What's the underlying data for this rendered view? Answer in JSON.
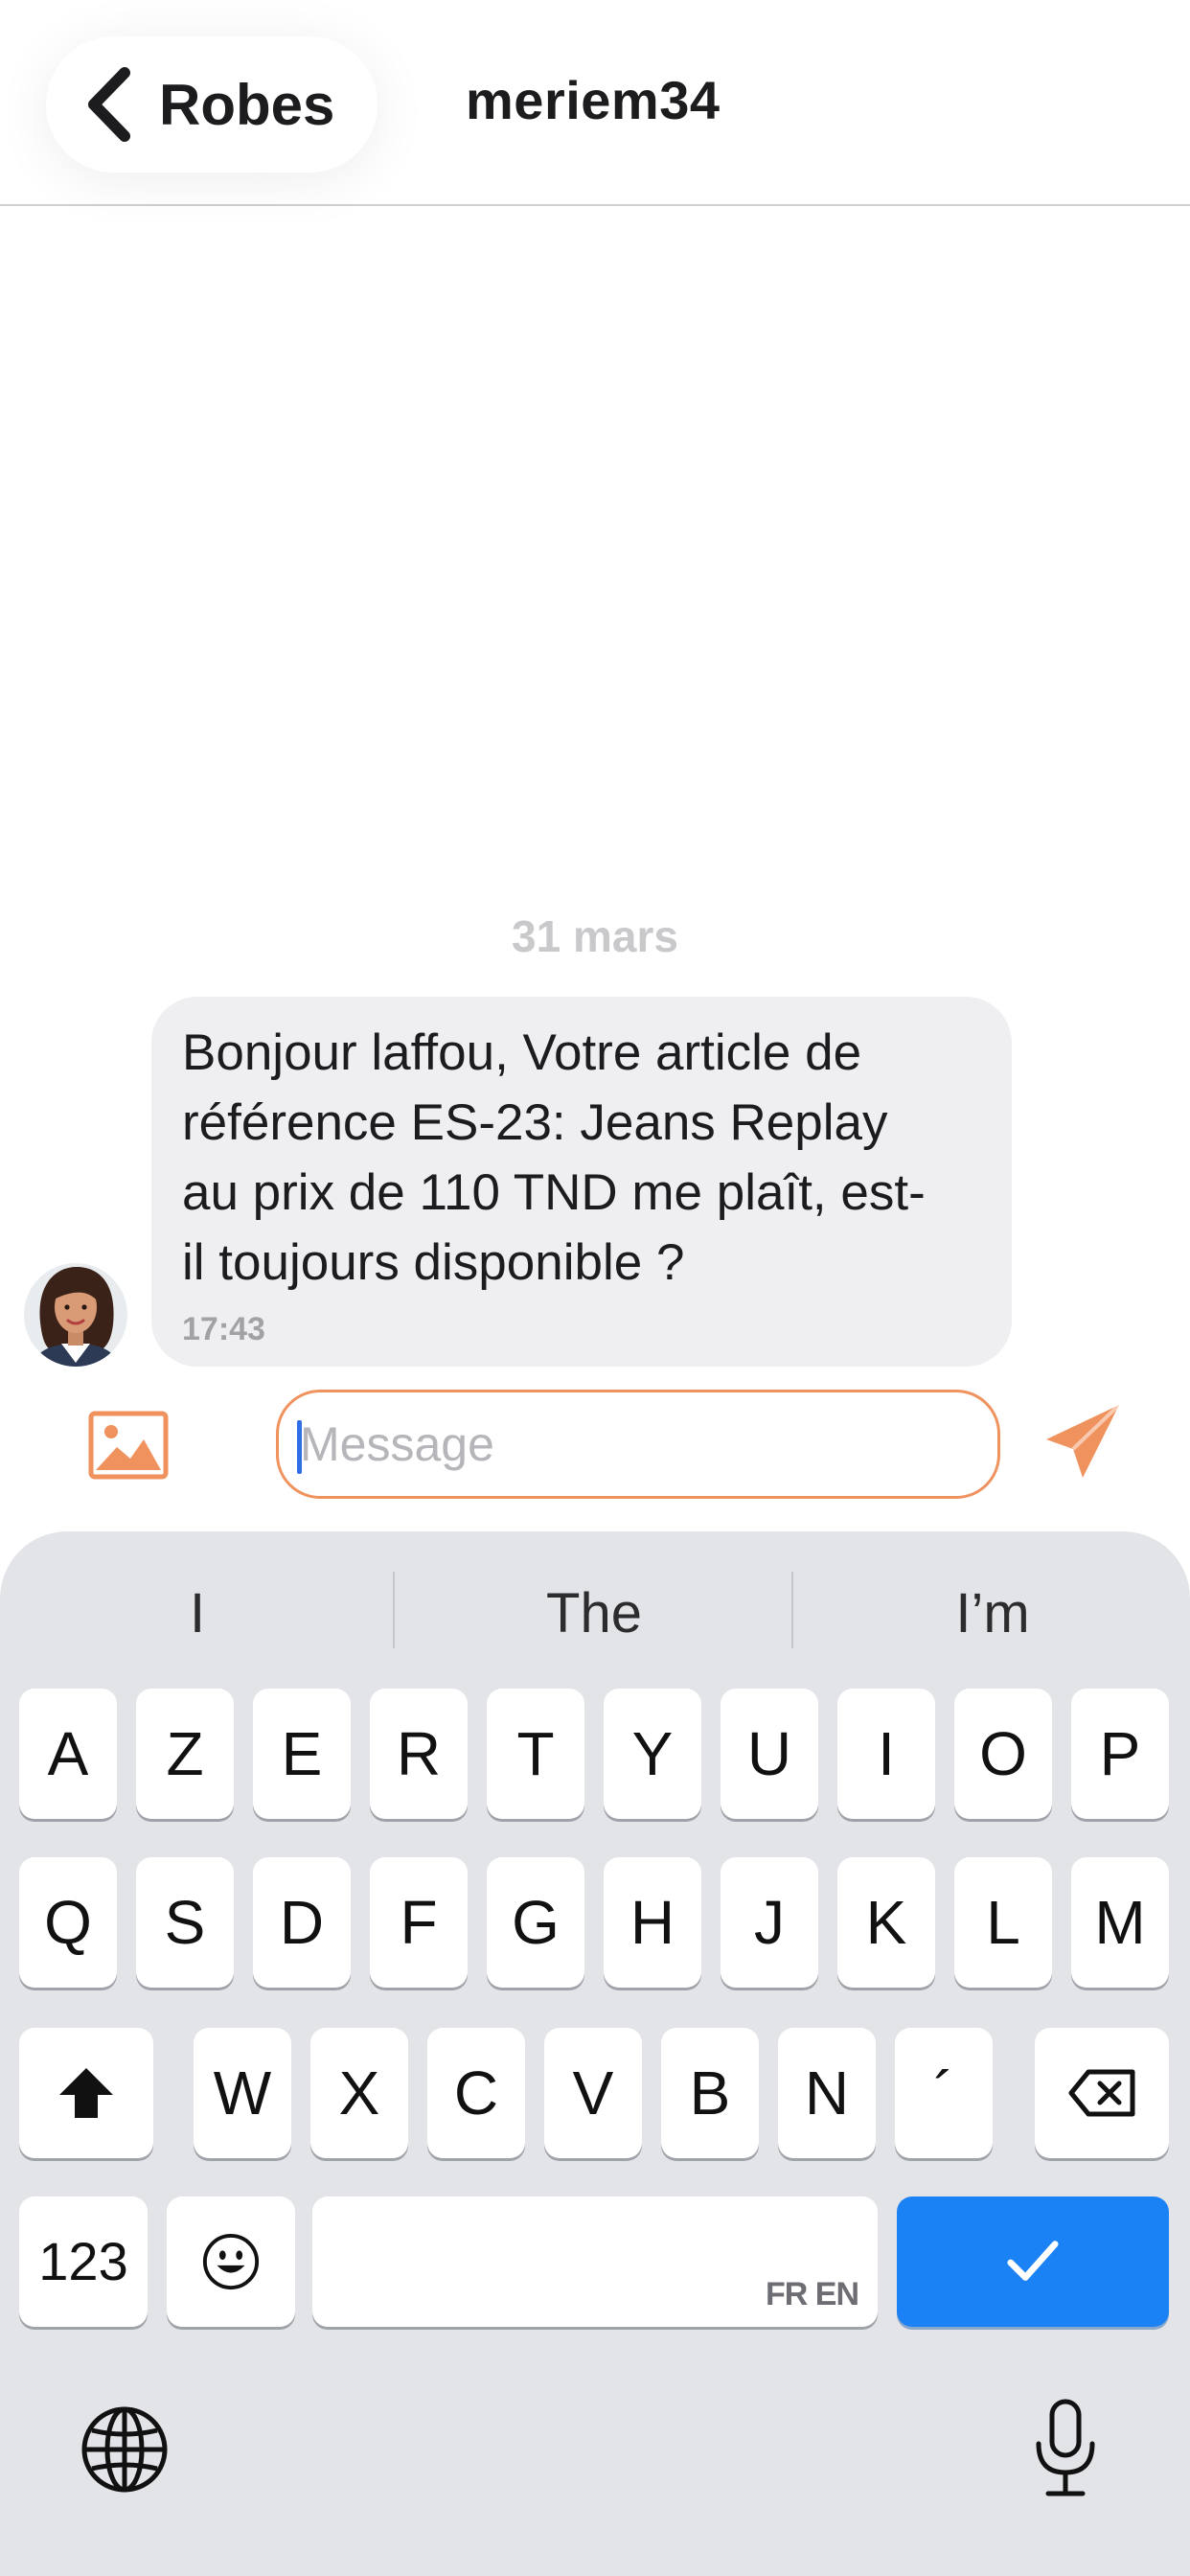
{
  "header": {
    "back_label": "Robes",
    "title": "meriem34"
  },
  "conversation": {
    "date": "31 mars",
    "message": {
      "text": "Bonjour laffou, Votre article de référence ES-23: Jeans Replay au prix de 110 TND me plaît, est-il toujours disponible ?",
      "lines": [
        "Bonjour laffou, Votre article de",
        "référence ES-23: Jeans Replay",
        "au prix de 110 TND me plaît, est-",
        "il toujours disponible ?"
      ],
      "time": "17:43"
    }
  },
  "composer": {
    "placeholder": "Message",
    "value": ""
  },
  "keyboard": {
    "suggestions": [
      "I",
      "The",
      "I’m"
    ],
    "row1": [
      "A",
      "Z",
      "E",
      "R",
      "T",
      "Y",
      "U",
      "I",
      "O",
      "P"
    ],
    "row2": [
      "Q",
      "S",
      "D",
      "F",
      "G",
      "H",
      "J",
      "K",
      "L",
      "M"
    ],
    "row3": [
      "W",
      "X",
      "C",
      "V",
      "B",
      "N",
      "´"
    ],
    "numbers_label": "123",
    "space_lang": "FR EN",
    "return_label": "✓"
  },
  "colors": {
    "accent": "#f0925e",
    "keyboard_bg": "#e2e4e8",
    "return_key": "#1a82f4",
    "bubble": "#efeff1"
  },
  "icons": {
    "back": "chevron-left-icon",
    "attach": "image-icon",
    "send": "send-icon",
    "shift": "shift-icon",
    "delete": "backspace-icon",
    "emoji": "emoji-icon",
    "globe": "globe-icon",
    "mic": "microphone-icon"
  }
}
